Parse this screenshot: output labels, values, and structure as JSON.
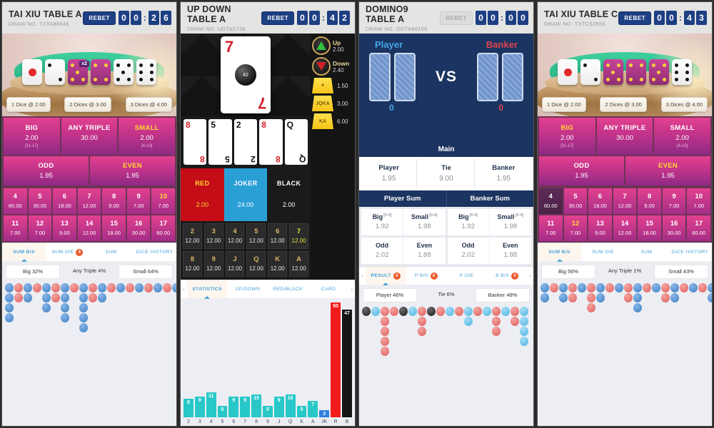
{
  "panels": [
    {
      "id": "taixiu-a",
      "type": "taixiu",
      "header": {
        "title": "TAI XIU TABLE A",
        "draw": "DRAW NO. TXTA86646",
        "rebet_label": "REBET",
        "rebet_enabled": true,
        "timer": [
          "0",
          "0",
          "2",
          "6"
        ]
      },
      "stage": {
        "dice_bets": [
          "1 Dice @ 2.00",
          "2 Dices @ 3.00",
          "3 Dices @ 4.00"
        ],
        "multiplier_tag": "x2"
      },
      "bets_top": [
        {
          "label": "BIG",
          "value": "2.00",
          "range": "[11-17]",
          "highlight": false
        },
        {
          "label": "ANY TRIPLE",
          "value": "30.00",
          "range": "",
          "highlight": false
        },
        {
          "label": "SMALL",
          "value": "2.00",
          "range": "[4-10]",
          "highlight": true
        }
      ],
      "bets_row2": [
        {
          "label": "ODD",
          "value": "1.95",
          "highlight": false
        },
        {
          "label": "EVEN",
          "value": "1.95",
          "highlight": true
        }
      ],
      "numbers": [
        [
          {
            "n": "4",
            "o": "60.00",
            "hot": false,
            "sel": false
          },
          {
            "n": "5",
            "o": "30.00",
            "hot": false,
            "sel": false
          },
          {
            "n": "6",
            "o": "18.00",
            "hot": false,
            "sel": false
          },
          {
            "n": "7",
            "o": "12.00",
            "hot": false,
            "sel": false
          },
          {
            "n": "8",
            "o": "9.00",
            "hot": false,
            "sel": false
          },
          {
            "n": "9",
            "o": "7.00",
            "hot": false,
            "sel": false
          },
          {
            "n": "10",
            "o": "7.00",
            "hot": true,
            "sel": false
          }
        ],
        [
          {
            "n": "11",
            "o": "7.00",
            "hot": false,
            "sel": false
          },
          {
            "n": "12",
            "o": "7.00",
            "hot": false,
            "sel": false
          },
          {
            "n": "13",
            "o": "9.00",
            "hot": false,
            "sel": false
          },
          {
            "n": "14",
            "o": "12.00",
            "hot": false,
            "sel": false
          },
          {
            "n": "15",
            "o": "18.00",
            "hot": false,
            "sel": false
          },
          {
            "n": "16",
            "o": "30.00",
            "hot": false,
            "sel": false
          },
          {
            "n": "17",
            "o": "60.00",
            "hot": false,
            "sel": false
          }
        ]
      ],
      "tabs": [
        {
          "label": "SUM B/S",
          "active": true,
          "badge": null
        },
        {
          "label": "SUM O/E",
          "active": false,
          "badge": "4"
        },
        {
          "label": "SUM",
          "active": false,
          "badge": null
        },
        {
          "label": "DICE HISTORY",
          "active": false,
          "badge": null
        }
      ],
      "stats": [
        "Big 32%",
        "Any Triple 4%",
        "Small 64%"
      ],
      "road": [
        [
          "blue",
          "blue",
          "blue",
          "blue"
        ],
        [
          "red",
          "red"
        ],
        [
          "blue",
          "blue"
        ],
        [
          "red"
        ],
        [
          "blue",
          "blue",
          "blue"
        ],
        [
          "red",
          "red"
        ],
        [
          "blue",
          "blue",
          "blue",
          "blue"
        ],
        [
          "red"
        ],
        [
          "blue",
          "blue",
          "blue",
          "blue",
          "blue"
        ],
        [
          "red",
          "red"
        ],
        [
          "blue",
          "blue"
        ],
        [
          "red"
        ],
        [
          "blue"
        ],
        [
          "red"
        ],
        [
          "blue"
        ],
        [
          "red"
        ],
        [
          "blue"
        ],
        [
          "red"
        ],
        [
          "blue"
        ],
        [
          "blue"
        ]
      ]
    },
    {
      "id": "updown-a",
      "type": "updown",
      "header": {
        "title": "UP DOWN TABLE A",
        "draw": "DRAW NO. UDTA5739",
        "rebet_label": "REBET",
        "rebet_enabled": true,
        "timer": [
          "0",
          "0",
          "4",
          "2"
        ]
      },
      "big_card": {
        "rank": "7",
        "suit_color": "red",
        "ball_value": "42"
      },
      "small_cards": [
        {
          "rank": "8",
          "color": "red"
        },
        {
          "rank": "5",
          "color": "black"
        },
        {
          "rank": "2",
          "color": "black"
        },
        {
          "rank": "8",
          "color": "red"
        },
        {
          "rank": "Q",
          "color": "black"
        }
      ],
      "side_bets": [
        {
          "icon": "triangle-up-icon",
          "label": "Up",
          "value": "2.00"
        },
        {
          "icon": "triangle-down-icon",
          "label": "Down",
          "value": "2.40"
        },
        {
          "icon": "equal-chip-icon",
          "label": "",
          "value": "1.50"
        },
        {
          "icon": "chip-icon",
          "label": "JQKA",
          "value": "3.00"
        },
        {
          "icon": "chip-icon",
          "label": "KA",
          "value": "6.00"
        }
      ],
      "color_bets": [
        {
          "label": "RED",
          "value": "2.00",
          "style": "red"
        },
        {
          "label": "JOKER",
          "value": "24.00",
          "style": "joker"
        },
        {
          "label": "BLACK",
          "value": "2.00",
          "style": "black"
        }
      ],
      "card_grid": [
        [
          {
            "n": "2",
            "o": "12.00",
            "hot": false
          },
          {
            "n": "3",
            "o": "12.00",
            "hot": false
          },
          {
            "n": "4",
            "o": "12.00",
            "hot": false
          },
          {
            "n": "5",
            "o": "12.00",
            "hot": false
          },
          {
            "n": "6",
            "o": "12.00",
            "hot": false
          },
          {
            "n": "7",
            "o": "12.00",
            "hot": true
          }
        ],
        [
          {
            "n": "8",
            "o": "12.00",
            "hot": false
          },
          {
            "n": "9",
            "o": "12.00",
            "hot": false
          },
          {
            "n": "J",
            "o": "12.00",
            "hot": false
          },
          {
            "n": "Q",
            "o": "12.00",
            "hot": false
          },
          {
            "n": "K",
            "o": "12.00",
            "hot": false
          },
          {
            "n": "A",
            "o": "12.00",
            "hot": false
          }
        ]
      ],
      "tabs": [
        {
          "label": "STATISTICS",
          "active": true,
          "badge": null
        },
        {
          "label": "UP/DOWN",
          "active": false,
          "badge": null
        },
        {
          "label": "RED/BLACK",
          "active": false,
          "badge": null
        },
        {
          "label": "CARD",
          "active": false,
          "badge": null
        }
      ],
      "chart_data": {
        "type": "bar",
        "title": "",
        "xlabel": "",
        "ylabel": "",
        "categories": [
          "2",
          "3",
          "4",
          "5",
          "6",
          "7",
          "8",
          "9",
          "J",
          "Q",
          "K",
          "A",
          "JK",
          "R",
          "B"
        ],
        "values": [
          8,
          9,
          11,
          5,
          9,
          9,
          10,
          5,
          9,
          10,
          5,
          7,
          3,
          50,
          47
        ],
        "colors": [
          "teal",
          "teal",
          "teal",
          "teal",
          "teal",
          "teal",
          "teal",
          "teal",
          "teal",
          "teal",
          "teal",
          "teal",
          "blue",
          "red",
          "black"
        ],
        "ylim": [
          0,
          50
        ],
        "grid": false,
        "legend": "none"
      }
    },
    {
      "id": "domino9-a",
      "type": "domino",
      "header": {
        "title": "DOMINO9 TABLE A",
        "draw": "DRAW NO. DOTA86106",
        "rebet_label": "REBET",
        "rebet_enabled": false,
        "timer": [
          "0",
          "0",
          "0",
          "0"
        ]
      },
      "table": {
        "player_label": "Player",
        "banker_label": "Banker",
        "vs_label": "VS",
        "player_score": "0",
        "banker_score": "0",
        "main_label": "Main"
      },
      "main_bets": [
        {
          "label": "Player",
          "value": "1.95"
        },
        {
          "label": "Tie",
          "value": "9.00"
        },
        {
          "label": "Banker",
          "value": "1.95"
        }
      ],
      "sum_headers": [
        "Player Sum",
        "Banker Sum"
      ],
      "sum_bets": {
        "player": [
          [
            {
              "label": "Big",
              "sup": "[5-9]",
              "value": "1.92"
            },
            {
              "label": "Small",
              "sup": "[0-4]",
              "value": "1.98"
            }
          ],
          [
            {
              "label": "Odd",
              "sup": "",
              "value": "2.02"
            },
            {
              "label": "Even",
              "sup": "",
              "value": "1.88"
            }
          ]
        ],
        "banker": [
          [
            {
              "label": "Big",
              "sup": "[5-9]",
              "value": "1.92"
            },
            {
              "label": "Small",
              "sup": "[0-4]",
              "value": "1.98"
            }
          ],
          [
            {
              "label": "Odd",
              "sup": "",
              "value": "2.02"
            },
            {
              "label": "Even",
              "sup": "",
              "value": "1.88"
            }
          ]
        ]
      },
      "tabs": [
        {
          "label": "RESULT",
          "active": true,
          "badge": "4"
        },
        {
          "label": "P B/S",
          "active": false,
          "badge": "4"
        },
        {
          "label": "P O/E",
          "active": false,
          "badge": null
        },
        {
          "label": "B B/S",
          "active": false,
          "badge": "4"
        }
      ],
      "stats": [
        "Player 46%",
        "Tie 6%",
        "Banker 48%"
      ],
      "road": [
        [
          "dark"
        ],
        [
          "cyan"
        ],
        [
          "red",
          "red",
          "red",
          "red",
          "red"
        ],
        [
          "red"
        ],
        [
          "dark"
        ],
        [
          "cyan"
        ],
        [
          "red",
          "red",
          "red"
        ],
        [
          "dark"
        ],
        [
          "red"
        ],
        [
          "cyan"
        ],
        [
          "red"
        ],
        [
          "cyan",
          "cyan"
        ],
        [
          "red"
        ],
        [
          "cyan"
        ],
        [
          "red",
          "red",
          "red"
        ],
        [
          "cyan"
        ],
        [
          "red",
          "red"
        ],
        [
          "cyan",
          "cyan",
          "cyan",
          "cyan"
        ]
      ]
    },
    {
      "id": "taixiu-c",
      "type": "taixiu",
      "header": {
        "title": "TAI XIU TABLE C",
        "draw": "DRAW NO. TXTC52565",
        "rebet_label": "REBET",
        "rebet_enabled": true,
        "timer": [
          "0",
          "0",
          "4",
          "3"
        ]
      },
      "stage": {
        "dice_bets": [
          "1 Dice @ 2.00",
          "2 Dices @ 3.00",
          "3 Dices @ 4.00"
        ],
        "multiplier_tag": ""
      },
      "bets_top": [
        {
          "label": "BIG",
          "value": "2.00",
          "range": "[11-17]",
          "highlight": true
        },
        {
          "label": "ANY TRIPLE",
          "value": "30.00",
          "range": "",
          "highlight": false
        },
        {
          "label": "SMALL",
          "value": "2.00",
          "range": "[4-10]",
          "highlight": false
        }
      ],
      "bets_row2": [
        {
          "label": "ODD",
          "value": "1.95",
          "highlight": false
        },
        {
          "label": "EVEN",
          "value": "1.95",
          "highlight": true
        }
      ],
      "numbers": [
        [
          {
            "n": "4",
            "o": "60.00",
            "hot": false,
            "sel": true
          },
          {
            "n": "5",
            "o": "30.00",
            "hot": false,
            "sel": false
          },
          {
            "n": "6",
            "o": "18.00",
            "hot": false,
            "sel": false
          },
          {
            "n": "7",
            "o": "12.00",
            "hot": false,
            "sel": false
          },
          {
            "n": "8",
            "o": "9.00",
            "hot": false,
            "sel": false
          },
          {
            "n": "9",
            "o": "7.00",
            "hot": false,
            "sel": false
          },
          {
            "n": "10",
            "o": "7.00",
            "hot": false,
            "sel": false
          }
        ],
        [
          {
            "n": "11",
            "o": "7.00",
            "hot": false,
            "sel": false
          },
          {
            "n": "12",
            "o": "7.00",
            "hot": true,
            "sel": false
          },
          {
            "n": "13",
            "o": "9.00",
            "hot": false,
            "sel": false
          },
          {
            "n": "14",
            "o": "12.00",
            "hot": false,
            "sel": false
          },
          {
            "n": "15",
            "o": "18.00",
            "hot": false,
            "sel": false
          },
          {
            "n": "16",
            "o": "30.00",
            "hot": false,
            "sel": false
          },
          {
            "n": "17",
            "o": "60.00",
            "hot": false,
            "sel": false
          }
        ]
      ],
      "tabs": [
        {
          "label": "SUM B/S",
          "active": true,
          "badge": null
        },
        {
          "label": "SUM O/E",
          "active": false,
          "badge": null
        },
        {
          "label": "SUM",
          "active": false,
          "badge": null
        },
        {
          "label": "DICE HISTORY",
          "active": false,
          "badge": null
        }
      ],
      "stats": [
        "Big 56%",
        "Any Triple 1%",
        "Small 43%"
      ],
      "road": [
        [
          "blue",
          "blue"
        ],
        [
          "red"
        ],
        [
          "blue",
          "blue"
        ],
        [
          "red",
          "red"
        ],
        [
          "blue"
        ],
        [
          "red",
          "red",
          "red"
        ],
        [
          "blue",
          "blue"
        ],
        [
          "red"
        ],
        [
          "blue"
        ],
        [
          "red",
          "red"
        ],
        [
          "blue",
          "blue",
          "blue"
        ],
        [
          "red"
        ],
        [
          "blue"
        ],
        [
          "red",
          "red"
        ],
        [
          "blue",
          "blue"
        ],
        [
          "red"
        ],
        [
          "blue"
        ],
        [
          "red"
        ],
        [
          "blue",
          "blue"
        ],
        [
          "red"
        ]
      ]
    }
  ],
  "colors": {
    "accent_blue": "#1d3f83",
    "magenta": "#c2338a",
    "tab_blue": "#4aa3d8",
    "badge_orange": "#ea5a2b",
    "teal_bar": "#28c8c8",
    "red_bar": "#f21b1b"
  }
}
